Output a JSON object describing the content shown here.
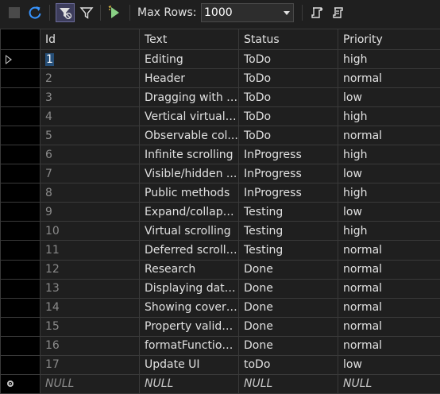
{
  "toolbar": {
    "max_rows_label": "Max Rows:",
    "max_rows_value": "1000",
    "icons": [
      "stop-icon",
      "refresh-icon",
      "filter-toggle-icon",
      "filter-icon",
      "run-icon",
      "script-icon",
      "script-alt-icon"
    ],
    "refresh_color": "#3794ff",
    "run_color": "#89d185"
  },
  "grid": {
    "columns": [
      "Id",
      "Text",
      "Status",
      "Priority"
    ],
    "rows": [
      {
        "id": "1",
        "text": "Editing",
        "status": "ToDo",
        "priority": "high"
      },
      {
        "id": "2",
        "text": "Header",
        "status": "ToDo",
        "priority": "normal"
      },
      {
        "id": "3",
        "text": "Dragging with f...",
        "status": "ToDo",
        "priority": "low"
      },
      {
        "id": "4",
        "text": "Vertical virtualiz...",
        "status": "ToDo",
        "priority": "high"
      },
      {
        "id": "5",
        "text": "Observable col...",
        "status": "ToDo",
        "priority": "normal"
      },
      {
        "id": "6",
        "text": "Infinite scrolling",
        "status": "InProgress",
        "priority": "high"
      },
      {
        "id": "7",
        "text": "Visible/hidden ...",
        "status": "InProgress",
        "priority": "low"
      },
      {
        "id": "8",
        "text": "Public methods",
        "status": "InProgress",
        "priority": "high"
      },
      {
        "id": "9",
        "text": "Expand/collaps...",
        "status": "Testing",
        "priority": "low"
      },
      {
        "id": "10",
        "text": "Virtual scrolling",
        "status": "Testing",
        "priority": "high"
      },
      {
        "id": "11",
        "text": "Deferred scrolli...",
        "status": "Testing",
        "priority": "normal"
      },
      {
        "id": "12",
        "text": "Research",
        "status": "Done",
        "priority": "normal"
      },
      {
        "id": "13",
        "text": "Displaying data...",
        "status": "Done",
        "priority": "normal"
      },
      {
        "id": "14",
        "text": "Showing cover ...",
        "status": "Done",
        "priority": "normal"
      },
      {
        "id": "15",
        "text": "Property validat...",
        "status": "Done",
        "priority": "normal"
      },
      {
        "id": "16",
        "text": "formatFunction ...",
        "status": "Done",
        "priority": "normal"
      },
      {
        "id": "17",
        "text": "Update UI",
        "status": "toDo",
        "priority": "low"
      }
    ],
    "null_row": {
      "id": "NULL",
      "text": "NULL",
      "status": "NULL",
      "priority": "NULL"
    },
    "selection_color": "#264f78"
  }
}
